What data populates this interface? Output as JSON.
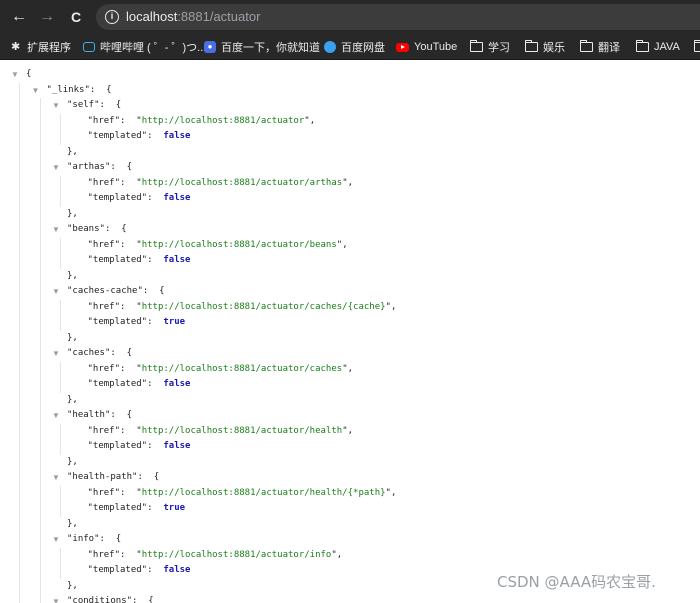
{
  "browser": {
    "nav": {
      "back_icon": "←",
      "forward_icon": "→",
      "reload_icon": "C"
    },
    "url": {
      "host": "localhost",
      "rest": ":8881/actuator"
    }
  },
  "bookmarks": [
    {
      "label": "扩展程序",
      "icon": "puzzle-icon"
    },
    {
      "label": "哔哩哔哩 ( ゜- ゜)つ...",
      "icon": "bilibili-icon"
    },
    {
      "label": "百度一下，你就知道",
      "icon": "baidu-icon"
    },
    {
      "label": "百度网盘",
      "icon": "baidu-cloud-icon"
    },
    {
      "label": "YouTube",
      "icon": "youtube-icon"
    },
    {
      "label": "学习",
      "icon": "folder-icon"
    },
    {
      "label": "娱乐",
      "icon": "folder-icon"
    },
    {
      "label": "翻译",
      "icon": "folder-icon"
    },
    {
      "label": "JAVA",
      "icon": "folder-icon"
    }
  ],
  "json": {
    "root_key": "_links",
    "entries": [
      {
        "key": "self",
        "href": "http://localhost:8881/actuator",
        "templated": "false"
      },
      {
        "key": "arthas",
        "href": "http://localhost:8881/actuator/arthas",
        "templated": "false"
      },
      {
        "key": "beans",
        "href": "http://localhost:8881/actuator/beans",
        "templated": "false"
      },
      {
        "key": "caches-cache",
        "href": "http://localhost:8881/actuator/caches/{cache}",
        "templated": "true"
      },
      {
        "key": "caches",
        "href": "http://localhost:8881/actuator/caches",
        "templated": "false"
      },
      {
        "key": "health",
        "href": "http://localhost:8881/actuator/health",
        "templated": "false"
      },
      {
        "key": "health-path",
        "href": "http://localhost:8881/actuator/health/{*path}",
        "templated": "true"
      },
      {
        "key": "info",
        "href": "http://localhost:8881/actuator/info",
        "templated": "false"
      }
    ],
    "next_key_partial": "conditions"
  },
  "watermark": "CSDN @AAA码农宝哥."
}
